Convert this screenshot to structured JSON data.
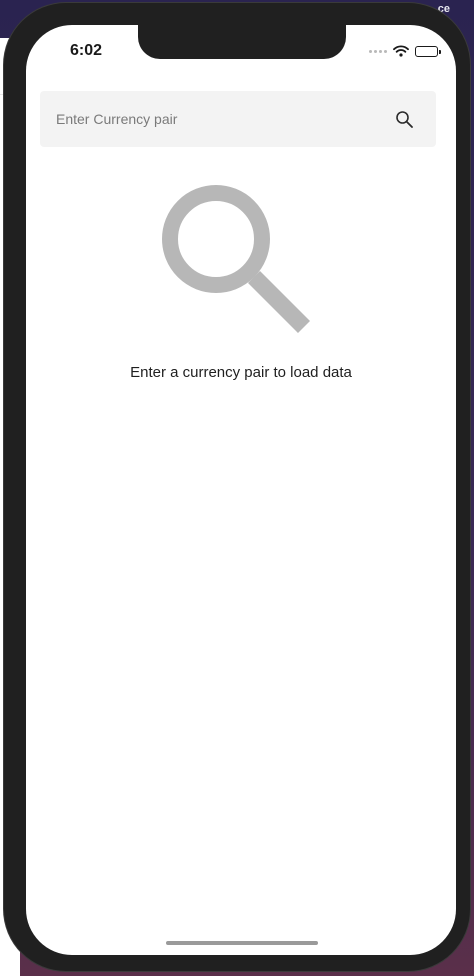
{
  "background": {
    "partial_label": "ce"
  },
  "status_bar": {
    "time": "6:02"
  },
  "search": {
    "placeholder": "Enter Currency pair",
    "value": ""
  },
  "empty_state": {
    "message": "Enter a currency pair to load data",
    "icon": "search-icon"
  },
  "colors": {
    "empty_icon": "#b7b7b7",
    "search_bar_bg": "#f3f3f3"
  }
}
